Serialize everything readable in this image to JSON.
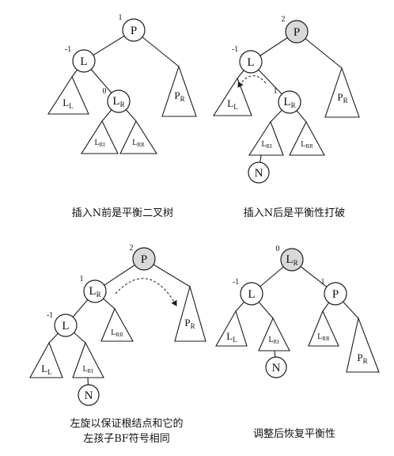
{
  "colors": {
    "highlight_fill": "#d9d9d9"
  },
  "panels": [
    {
      "caption": [
        "插入N前是平衡二叉树"
      ],
      "nodes": {
        "p": {
          "label": "P",
          "bf": "1"
        },
        "l": {
          "label": "L",
          "bf": "-1"
        },
        "lr": {
          "label": "L",
          "sub": "R",
          "bf": "0"
        }
      },
      "subtrees": {
        "ll": {
          "label": "L",
          "sub": "L"
        },
        "lri": {
          "label": "L",
          "sub": "RI"
        },
        "lrr": {
          "label": "L",
          "sub": "RR"
        },
        "pr": {
          "label": "P",
          "sub": "R"
        }
      }
    },
    {
      "caption": [
        "插入N后是平衡性打破"
      ],
      "nodes": {
        "p": {
          "label": "P",
          "bf": "2",
          "shaded": true
        },
        "l": {
          "label": "L",
          "bf": "-1"
        },
        "lr": {
          "label": "L",
          "sub": "R",
          "bf": "1"
        },
        "n": {
          "label": "N"
        }
      },
      "subtrees": {
        "ll": {
          "label": "L",
          "sub": "L"
        },
        "lri": {
          "label": "L",
          "sub": "RI"
        },
        "lrr": {
          "label": "L",
          "sub": "RR"
        },
        "pr": {
          "label": "P",
          "sub": "R"
        }
      }
    },
    {
      "caption": [
        "左旋以保证根结点和它的",
        "左孩子BF符号相同"
      ],
      "nodes": {
        "p": {
          "label": "P",
          "bf": "2",
          "shaded": true
        },
        "lr": {
          "label": "L",
          "sub": "R",
          "bf": "1"
        },
        "l": {
          "label": "L",
          "bf": "-1"
        },
        "n": {
          "label": "N"
        }
      },
      "subtrees": {
        "ll": {
          "label": "L",
          "sub": "L"
        },
        "lri": {
          "label": "L",
          "sub": "RI"
        },
        "lrr": {
          "label": "L",
          "sub": "RR"
        },
        "pr": {
          "label": "P",
          "sub": "R"
        }
      }
    },
    {
      "caption": [
        "调整后恢复平衡性"
      ],
      "nodes": {
        "lr": {
          "label": "L",
          "sub": "R",
          "bf": "0",
          "shaded": true
        },
        "l": {
          "label": "L",
          "bf": "-1"
        },
        "p": {
          "label": "P",
          "bf": "1"
        },
        "n": {
          "label": "N"
        }
      },
      "subtrees": {
        "ll": {
          "label": "L",
          "sub": "L"
        },
        "lri": {
          "label": "L",
          "sub": "RI"
        },
        "lrr": {
          "label": "L",
          "sub": "RR"
        },
        "pr": {
          "label": "P",
          "sub": "R"
        }
      }
    }
  ]
}
